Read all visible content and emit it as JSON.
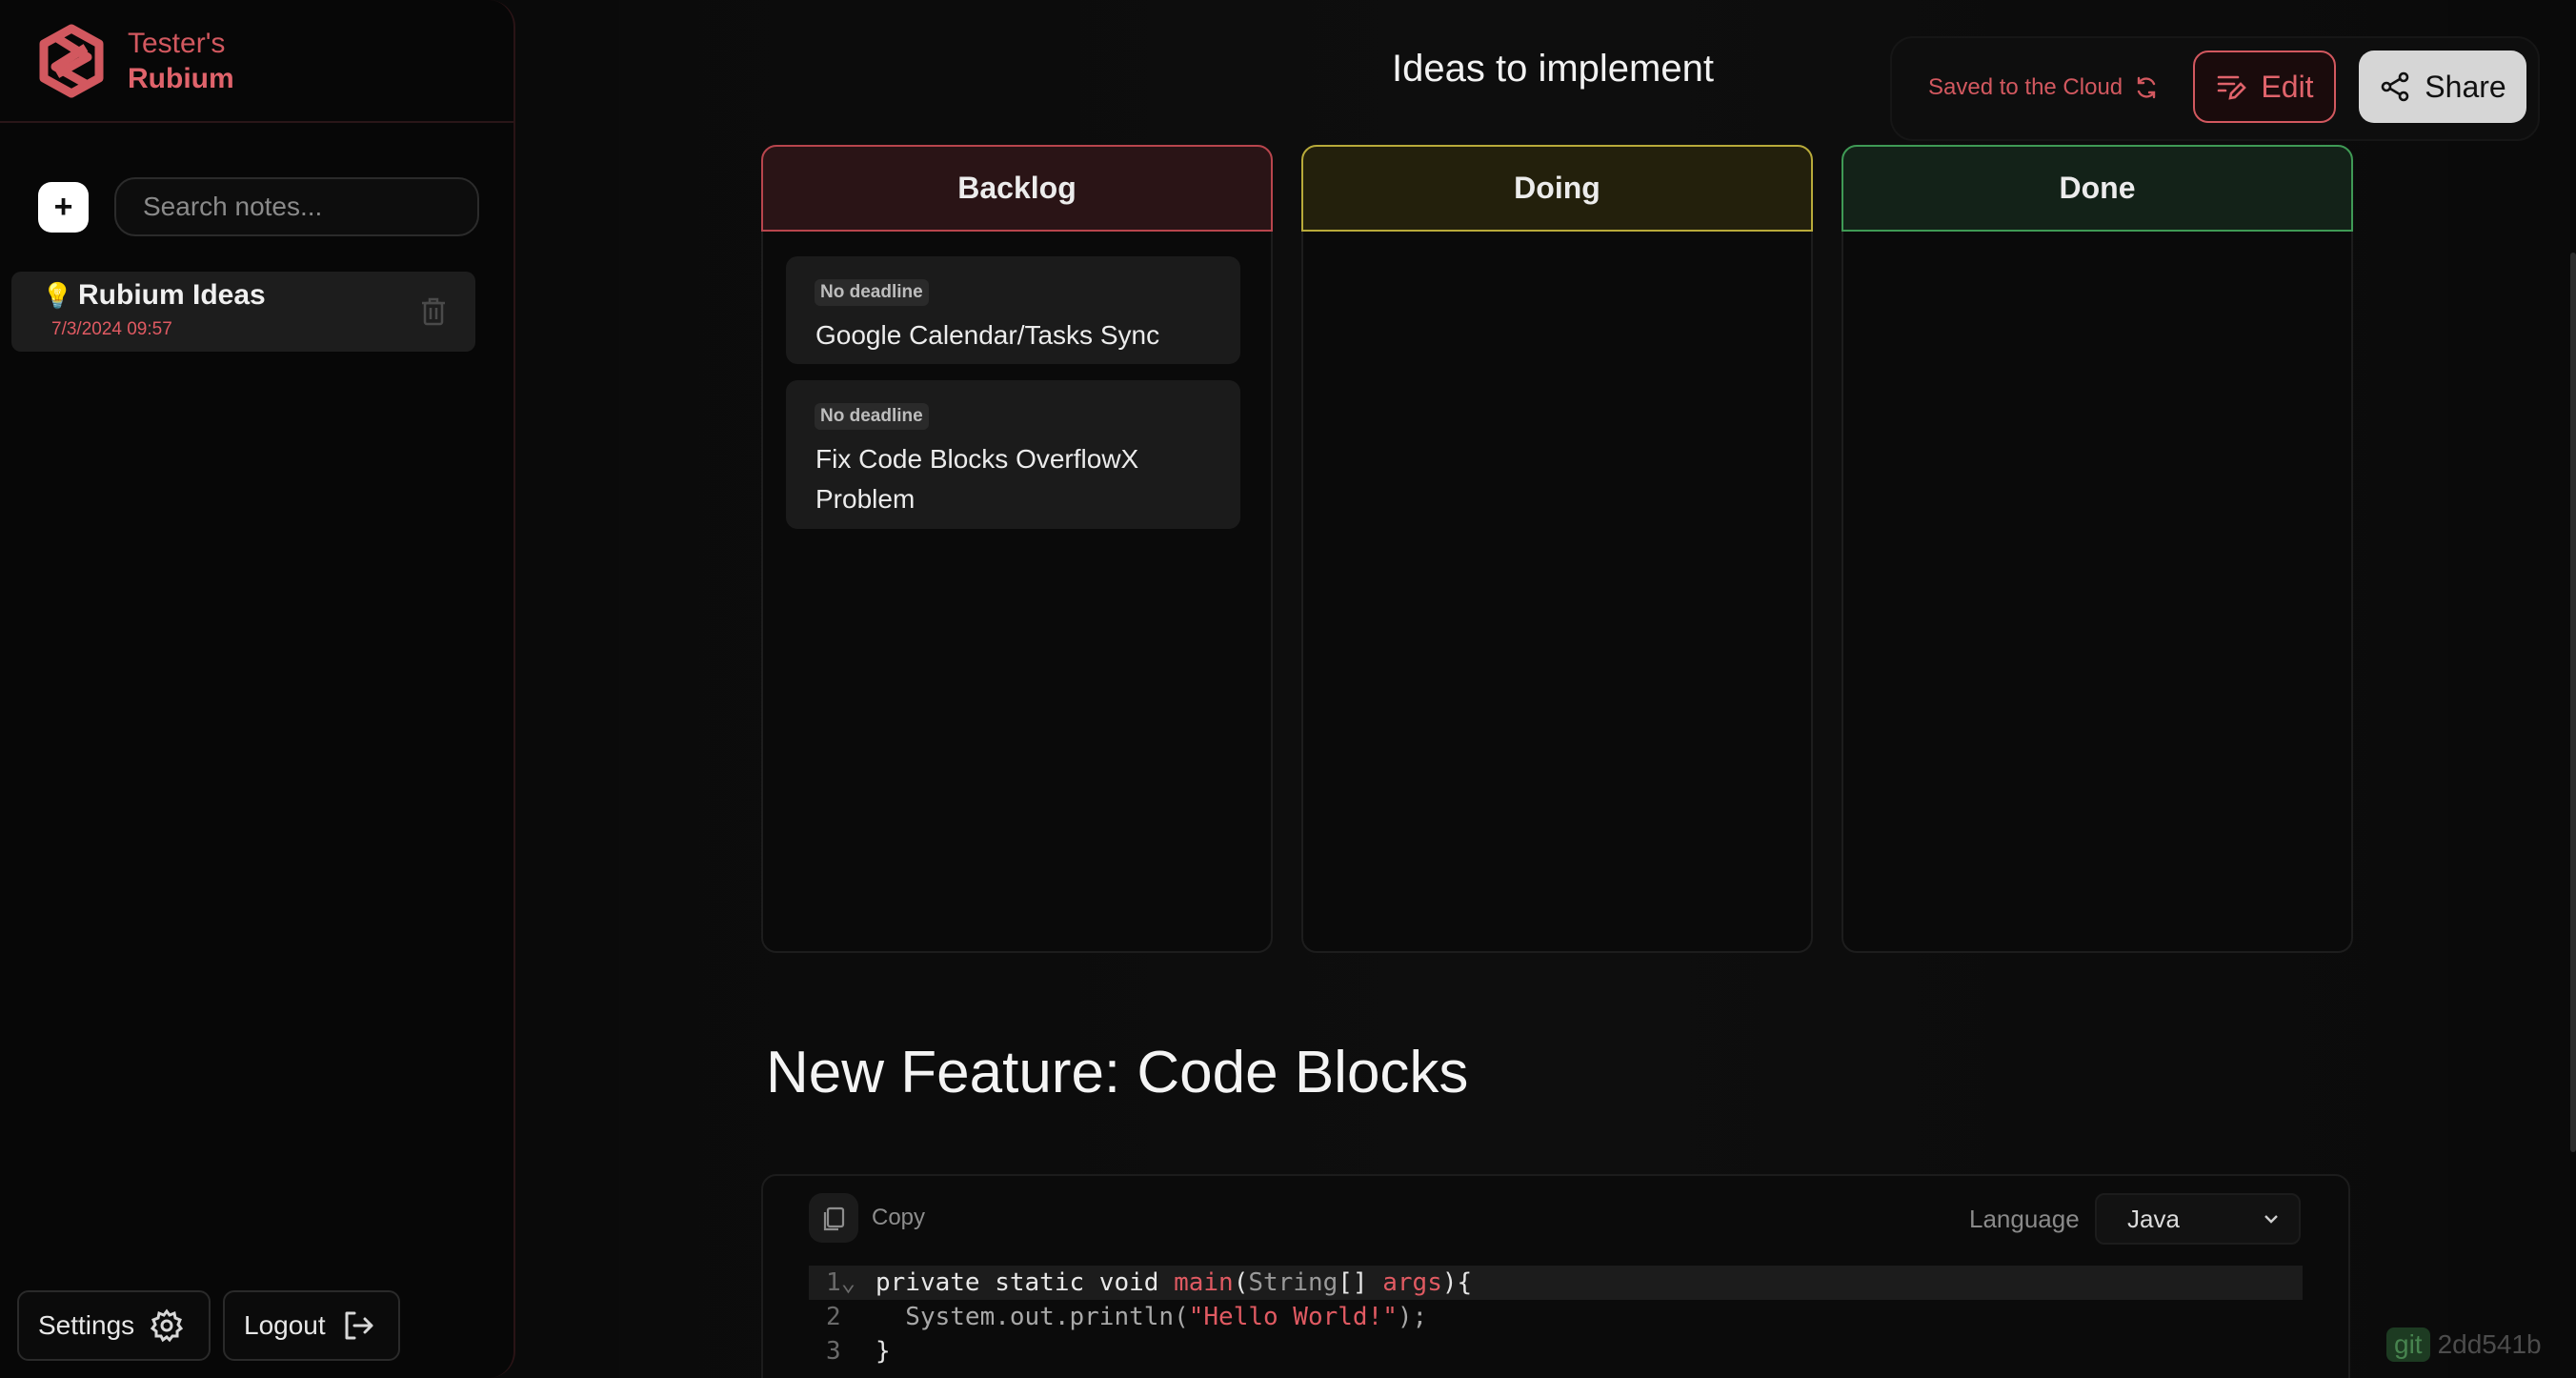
{
  "sidebar": {
    "brand": {
      "owner": "Tester's",
      "app": "Rubium"
    },
    "search": {
      "placeholder": "Search notes..."
    },
    "new_note_label": "+",
    "notes": [
      {
        "icon": "💡",
        "title": "Rubium Ideas",
        "date": "7/3/2024 09:57"
      }
    ],
    "settings_label": "Settings",
    "logout_label": "Logout"
  },
  "header": {
    "title": "Ideas to implement",
    "saved_status": "Saved to the Cloud",
    "edit_label": "Edit",
    "share_label": "Share"
  },
  "kanban": {
    "columns": [
      {
        "title": "Backlog",
        "cards": [
          {
            "deadline": "No deadline",
            "title": "Google Calendar/Tasks Sync"
          },
          {
            "deadline": "No deadline",
            "title": "Fix Code Blocks OverflowX Problem"
          }
        ]
      },
      {
        "title": "Doing",
        "cards": []
      },
      {
        "title": "Done",
        "cards": []
      }
    ]
  },
  "content": {
    "heading": "New Feature: Code Blocks",
    "code_block": {
      "copy_label": "Copy",
      "language_label": "Language",
      "language": "Java",
      "line_numbers": [
        "1",
        "2",
        "3"
      ]
    }
  },
  "footer": {
    "git_tag": "git",
    "commit": "2dd541b"
  },
  "colors": {
    "accent": "#e0636b",
    "backlog": "#b8454d",
    "doing": "#b8aa3a",
    "done": "#3f9a55"
  }
}
